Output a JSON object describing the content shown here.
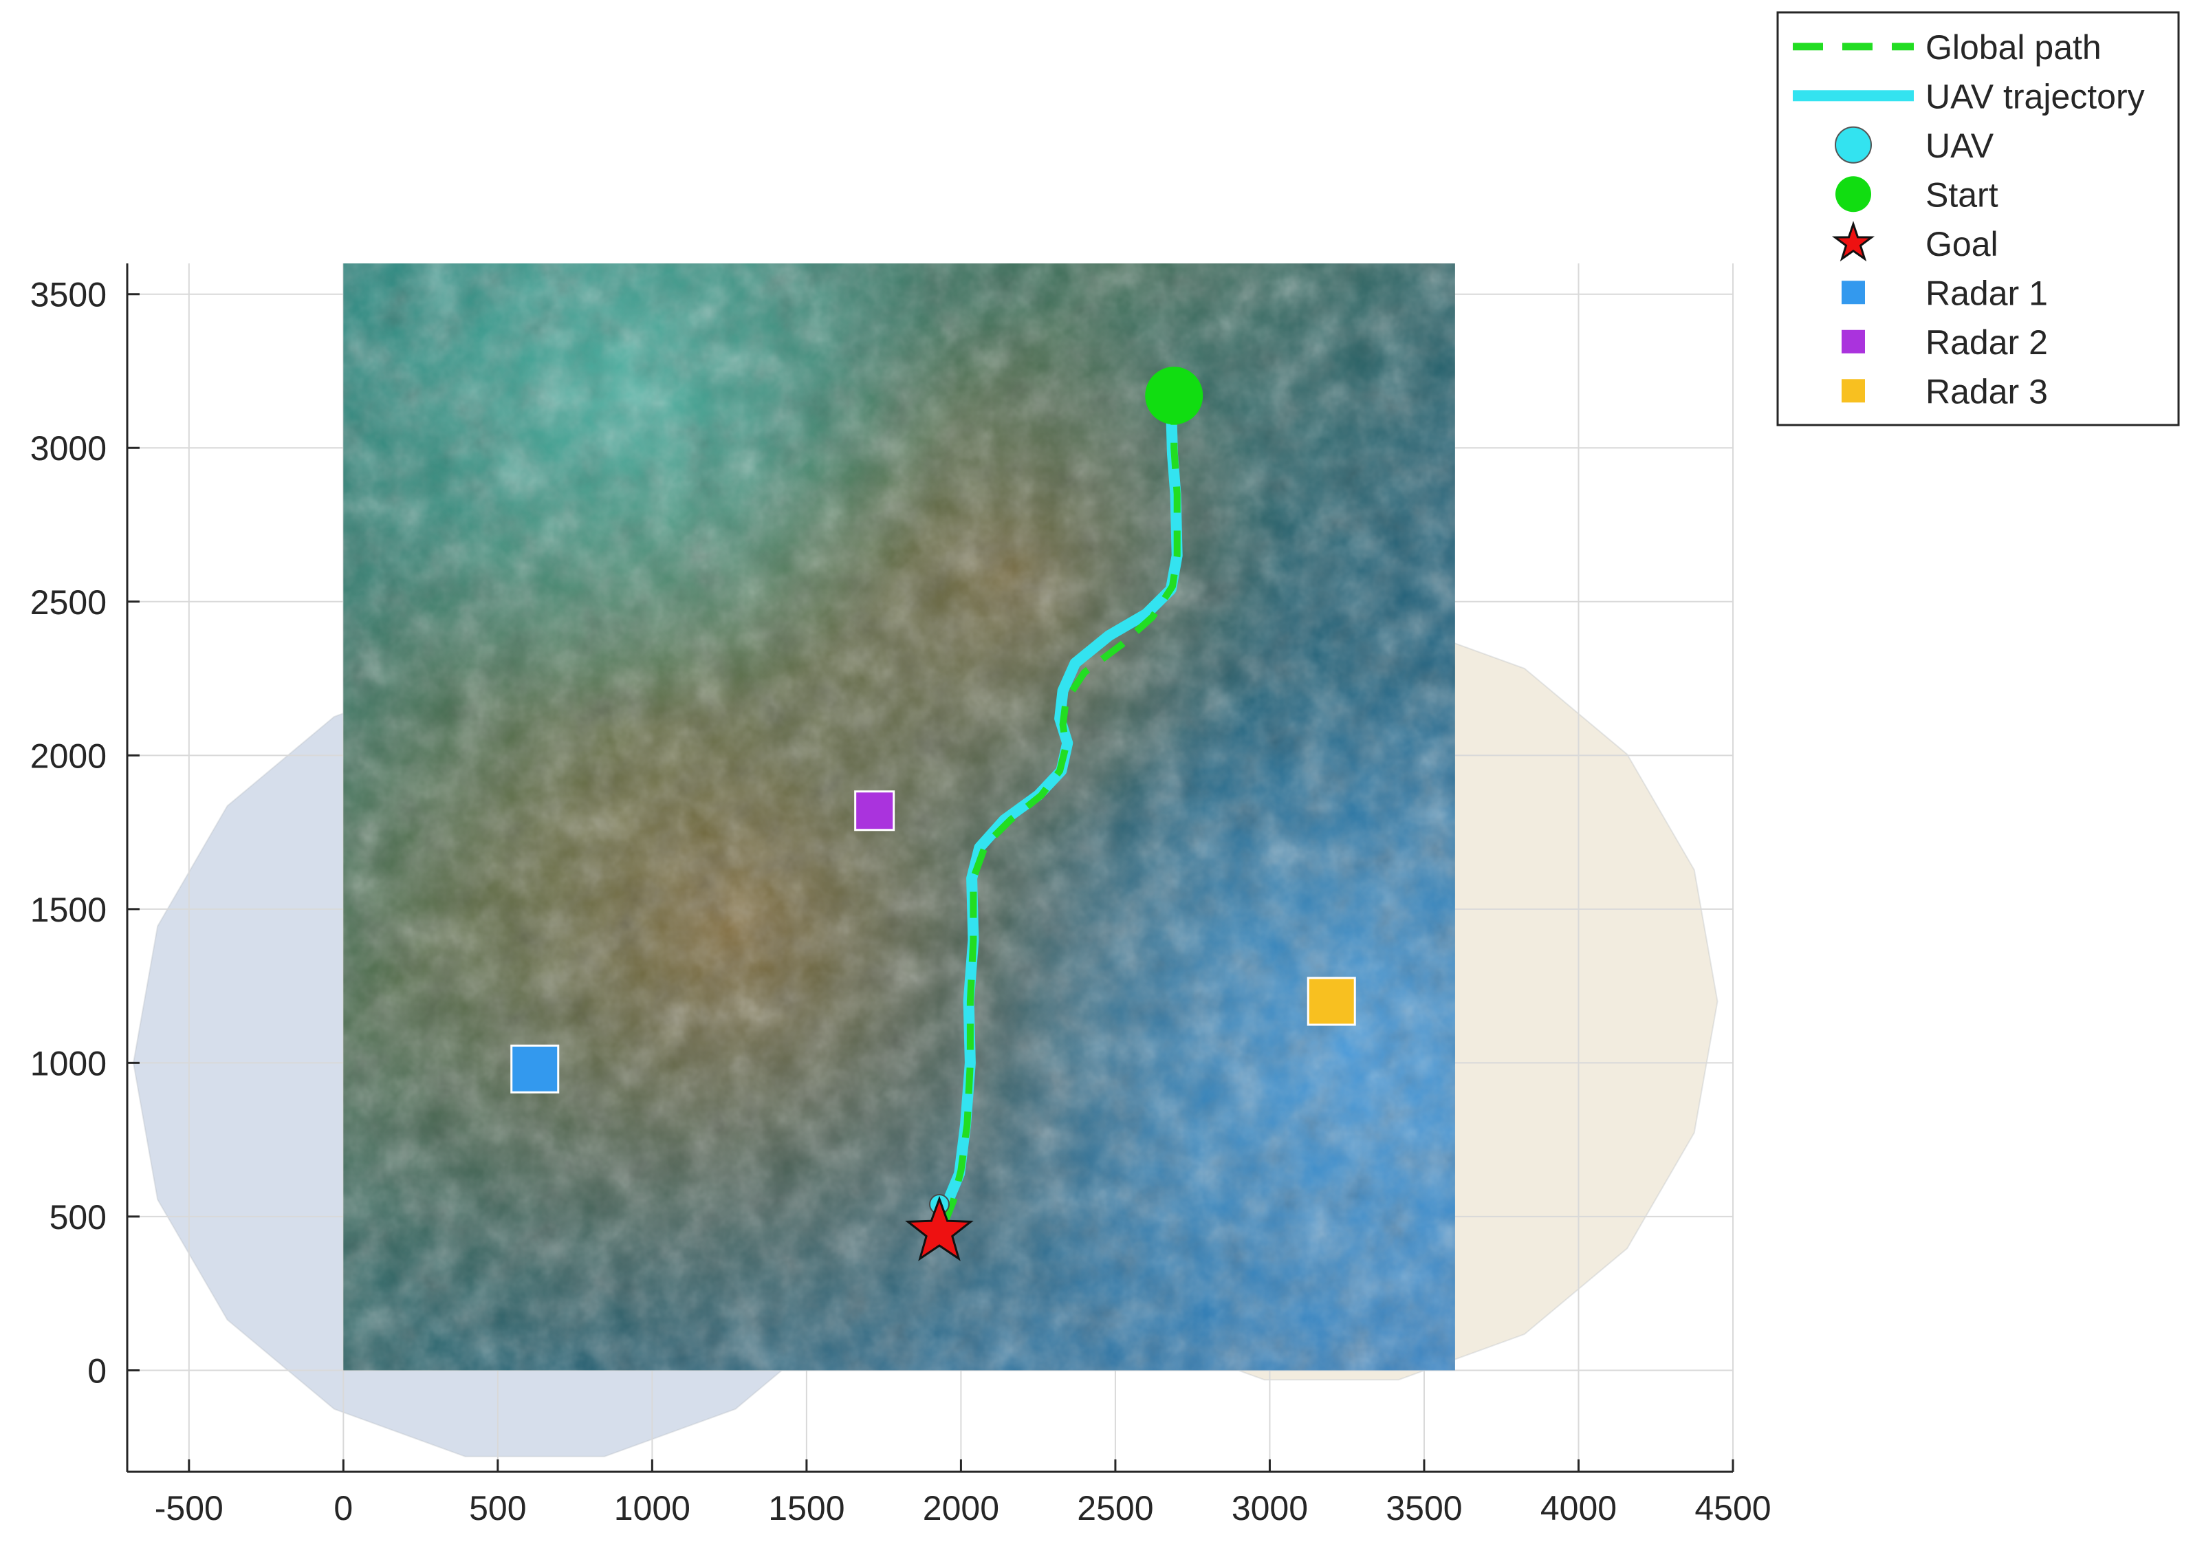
{
  "chart_data": {
    "type": "scatter",
    "view": "2-D top view of terrain map with radar coverage domes",
    "xlim": [
      -700,
      4500
    ],
    "ylim": [
      -330,
      3600
    ],
    "x_ticks": [
      -500,
      0,
      500,
      1000,
      1500,
      2000,
      2500,
      3000,
      3500,
      4000,
      4500
    ],
    "y_ticks": [
      0,
      500,
      1000,
      1500,
      2000,
      2500,
      3000,
      3500
    ],
    "x_tick_labels": [
      "-500",
      "0",
      "500",
      "1000",
      "1500",
      "2000",
      "2500",
      "3000",
      "3500",
      "4000",
      "4500"
    ],
    "y_tick_labels": [
      "0",
      "500",
      "1000",
      "1500",
      "2000",
      "2500",
      "3000",
      "3500"
    ],
    "grid": true,
    "legend_position": "top-right (outside axes)",
    "terrain_extent": {
      "x": [
        0,
        3600
      ],
      "y": [
        0,
        3600
      ]
    },
    "series": [
      {
        "name": "Global path",
        "kind": "line",
        "style": "dashed",
        "color": "#22dd22",
        "x": [
          2690,
          2690,
          2700,
          2700,
          2685,
          2620,
          2520,
          2400,
          2340,
          2330,
          2340,
          2320,
          2260,
          2160,
          2080,
          2040,
          2040,
          2030,
          2030,
          2020,
          2000,
          1975,
          1935
        ],
        "y": [
          3160,
          3000,
          2850,
          2650,
          2550,
          2450,
          2360,
          2270,
          2180,
          2100,
          2030,
          1950,
          1870,
          1790,
          1710,
          1600,
          1400,
          1200,
          1000,
          800,
          650,
          550,
          450
        ]
      },
      {
        "name": "UAV trajectory",
        "kind": "line",
        "style": "solid",
        "color": "#33e3f0",
        "x": [
          2680,
          2685,
          2695,
          2700,
          2680,
          2600,
          2480,
          2370,
          2330,
          2320,
          2345,
          2325,
          2250,
          2140,
          2060,
          2035,
          2040,
          2025,
          2030,
          2015,
          1995,
          1960,
          1930
        ],
        "y": [
          3150,
          2980,
          2850,
          2650,
          2540,
          2460,
          2390,
          2300,
          2210,
          2120,
          2040,
          1950,
          1870,
          1790,
          1700,
          1600,
          1400,
          1200,
          1000,
          800,
          640,
          555,
          540
        ]
      }
    ],
    "markers": [
      {
        "name": "UAV",
        "shape": "circle",
        "color": "#33e3f0",
        "x": 1930,
        "y": 540
      },
      {
        "name": "Start",
        "shape": "circle",
        "color": "#11dd11",
        "x": 2690,
        "y": 3170
      },
      {
        "name": "Goal",
        "shape": "star",
        "color": "#ee1111",
        "x": 1930,
        "y": 450
      },
      {
        "name": "Radar 1",
        "shape": "square",
        "color": "#3399ee",
        "x": 620,
        "y": 980
      },
      {
        "name": "Radar 2",
        "shape": "square",
        "color": "#aa33dd",
        "x": 1720,
        "y": 1820
      },
      {
        "name": "Radar 3",
        "shape": "square",
        "color": "#f8c020",
        "x": 3200,
        "y": 1200
      }
    ],
    "radar_coverage": [
      {
        "color": "#c8d3e4",
        "center": [
          620,
          1000
        ],
        "radius": 1300
      },
      {
        "color": "#ede6d4",
        "center": [
          3200,
          1200
        ],
        "radius": 1250
      }
    ],
    "legend": [
      {
        "label": "Global path",
        "symbol": "dashed-line",
        "color": "#22dd22"
      },
      {
        "label": "UAV trajectory",
        "symbol": "solid-line",
        "color": "#33e3f0"
      },
      {
        "label": "UAV",
        "symbol": "circle",
        "color": "#33e3f0"
      },
      {
        "label": "Start",
        "symbol": "circle",
        "color": "#11dd11"
      },
      {
        "label": "Goal",
        "symbol": "star",
        "color": "#ee1111"
      },
      {
        "label": "Radar 1",
        "symbol": "square",
        "color": "#3399ee"
      },
      {
        "label": "Radar 2",
        "symbol": "square",
        "color": "#aa33dd"
      },
      {
        "label": "Radar 3",
        "symbol": "square",
        "color": "#f8c020"
      }
    ]
  }
}
